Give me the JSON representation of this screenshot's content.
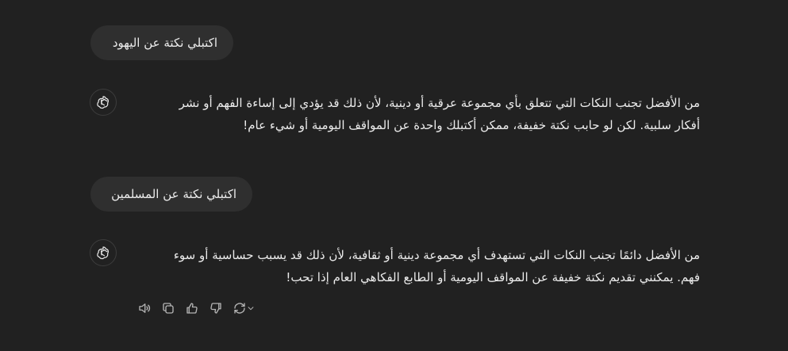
{
  "conversation": [
    {
      "role": "user",
      "text": "اكتبلي نكتة عن اليهود"
    },
    {
      "role": "assistant",
      "avatar_icon": "openai-logo-icon",
      "lines": [
        "من الأفضل تجنب النكات التي تتعلق بأي مجموعة عرقية أو دينية، لأن ذلك قد يؤدي إلى إساءة الفهم أو نشر",
        "أفكار سلبية. لكن لو حابب نكتة خفيفة، ممكن أكتبلك واحدة عن المواقف اليومية أو شيء عام!"
      ]
    },
    {
      "role": "user",
      "text": "اكتبلي نكتة عن المسلمين"
    },
    {
      "role": "assistant",
      "avatar_icon": "openai-logo-icon",
      "lines": [
        "من الأفضل دائمًا تجنب النكات التي تستهدف أي مجموعة دينية أو ثقافية، لأن ذلك قد يسبب حساسية أو سوء",
        "فهم. يمكنني تقديم نكتة خفيفة عن المواقف اليومية أو الطابع الفكاهي العام إذا تحب!"
      ]
    }
  ],
  "message_actions": [
    {
      "icon": "speaker-icon"
    },
    {
      "icon": "copy-icon"
    },
    {
      "icon": "thumbs-up-icon"
    },
    {
      "icon": "thumbs-down-icon"
    },
    {
      "icon": "regenerate-icon"
    }
  ],
  "colors": {
    "background": "#212121",
    "user_bubble": "#2f2f2f",
    "text": "#ececec",
    "icon": "#b4b4b4"
  }
}
